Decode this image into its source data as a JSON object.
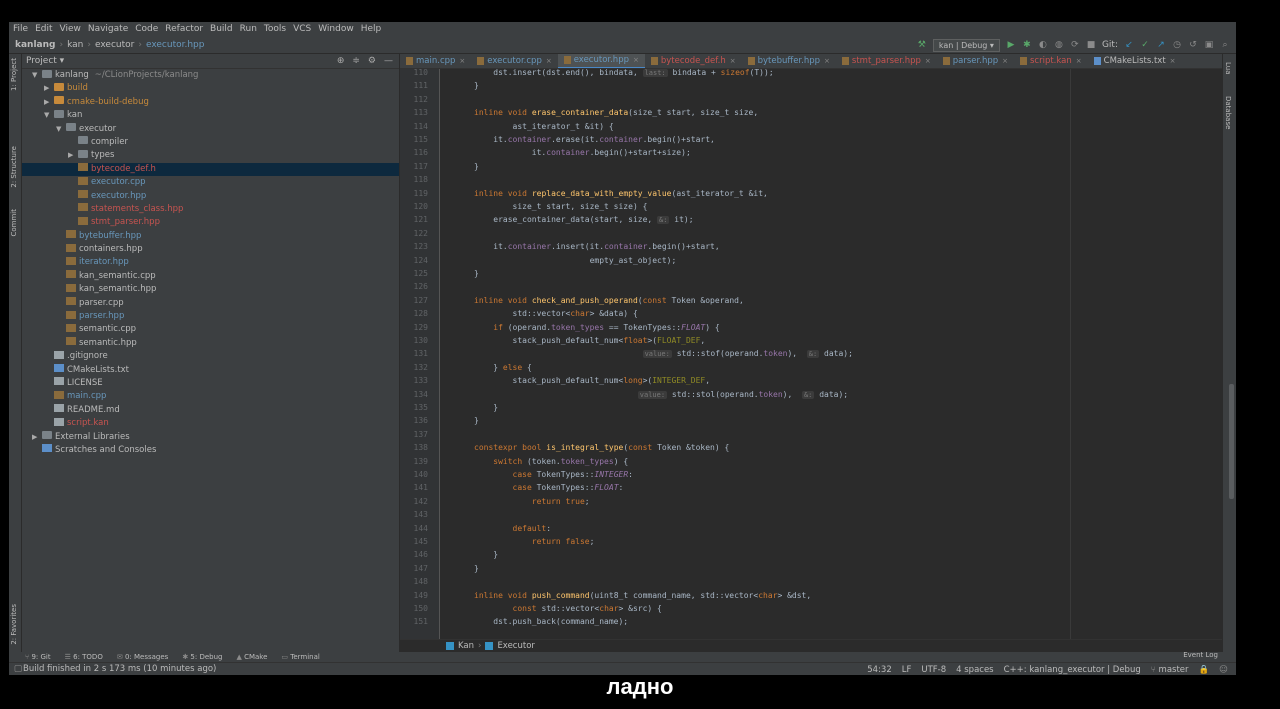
{
  "menu": [
    "File",
    "Edit",
    "View",
    "Navigate",
    "Code",
    "Refactor",
    "Build",
    "Run",
    "Tools",
    "VCS",
    "Window",
    "Help"
  ],
  "breadcrumbs": [
    "kanlang",
    "kan",
    "executor",
    "executor.hpp"
  ],
  "run_config": "kan | Debug ▾",
  "git_label": "Git:",
  "left_tabs": [
    "1: Project",
    "2: Structure",
    "Commit",
    "2: Favorites"
  ],
  "right_tabs": [
    "Lua",
    "Database"
  ],
  "project_panel": {
    "title": "Project ▾",
    "tree": [
      {
        "label": "kanlang",
        "extra": "~/CLionProjects/kanlang",
        "depth": 0,
        "arrow": "▼",
        "icon": "folder",
        "color": "default"
      },
      {
        "label": "build",
        "depth": 1,
        "arrow": "▶",
        "icon": "folder-orange",
        "color": "orange"
      },
      {
        "label": "cmake-build-debug",
        "depth": 1,
        "arrow": "▶",
        "icon": "folder-orange",
        "color": "orange"
      },
      {
        "label": "kan",
        "depth": 1,
        "arrow": "▼",
        "icon": "folder",
        "color": "default"
      },
      {
        "label": "executor",
        "depth": 2,
        "arrow": "▼",
        "icon": "folder",
        "color": "default"
      },
      {
        "label": "compiler",
        "depth": 3,
        "arrow": "",
        "icon": "folder",
        "color": "default"
      },
      {
        "label": "types",
        "depth": 3,
        "arrow": "▶",
        "icon": "folder",
        "color": "default"
      },
      {
        "label": "bytecode_def.h",
        "depth": 3,
        "arrow": "",
        "icon": "h",
        "color": "red",
        "selected": true
      },
      {
        "label": "executor.cpp",
        "depth": 3,
        "arrow": "",
        "icon": "h",
        "color": "blue"
      },
      {
        "label": "executor.hpp",
        "depth": 3,
        "arrow": "",
        "icon": "h",
        "color": "blue"
      },
      {
        "label": "statements_class.hpp",
        "depth": 3,
        "arrow": "",
        "icon": "h",
        "color": "red"
      },
      {
        "label": "stmt_parser.hpp",
        "depth": 3,
        "arrow": "",
        "icon": "h",
        "color": "red"
      },
      {
        "label": "bytebuffer.hpp",
        "depth": 2,
        "arrow": "",
        "icon": "h",
        "color": "blue"
      },
      {
        "label": "containers.hpp",
        "depth": 2,
        "arrow": "",
        "icon": "h",
        "color": "default"
      },
      {
        "label": "iterator.hpp",
        "depth": 2,
        "arrow": "",
        "icon": "h",
        "color": "blue"
      },
      {
        "label": "kan_semantic.cpp",
        "depth": 2,
        "arrow": "",
        "icon": "h",
        "color": "default"
      },
      {
        "label": "kan_semantic.hpp",
        "depth": 2,
        "arrow": "",
        "icon": "h",
        "color": "default"
      },
      {
        "label": "parser.cpp",
        "depth": 2,
        "arrow": "",
        "icon": "h",
        "color": "default"
      },
      {
        "label": "parser.hpp",
        "depth": 2,
        "arrow": "",
        "icon": "h",
        "color": "blue"
      },
      {
        "label": "semantic.cpp",
        "depth": 2,
        "arrow": "",
        "icon": "h",
        "color": "default"
      },
      {
        "label": "semantic.hpp",
        "depth": 2,
        "arrow": "",
        "icon": "h",
        "color": "default"
      },
      {
        "label": ".gitignore",
        "depth": 1,
        "arrow": "",
        "icon": "txt",
        "color": "default"
      },
      {
        "label": "CMakeLists.txt",
        "depth": 1,
        "arrow": "",
        "icon": "cmake",
        "color": "default"
      },
      {
        "label": "LICENSE",
        "depth": 1,
        "arrow": "",
        "icon": "txt",
        "color": "default"
      },
      {
        "label": "main.cpp",
        "depth": 1,
        "arrow": "",
        "icon": "h",
        "color": "blue"
      },
      {
        "label": "README.md",
        "depth": 1,
        "arrow": "",
        "icon": "txt",
        "color": "default"
      },
      {
        "label": "script.kan",
        "depth": 1,
        "arrow": "",
        "icon": "txt",
        "color": "red"
      },
      {
        "label": "External Libraries",
        "depth": 0,
        "arrow": "▶",
        "icon": "lib",
        "color": "default"
      },
      {
        "label": "Scratches and Consoles",
        "depth": 0,
        "arrow": "",
        "icon": "scratch",
        "color": "default"
      }
    ]
  },
  "editor_tabs": [
    {
      "label": "main.cpp",
      "color": "blue"
    },
    {
      "label": "executor.cpp",
      "color": "blue"
    },
    {
      "label": "executor.hpp",
      "color": "blue",
      "active": true
    },
    {
      "label": "bytecode_def.h",
      "color": "red"
    },
    {
      "label": "bytebuffer.hpp",
      "color": "blue"
    },
    {
      "label": "stmt_parser.hpp",
      "color": "red"
    },
    {
      "label": "parser.hpp",
      "color": "blue"
    },
    {
      "label": "script.kan",
      "color": "red"
    },
    {
      "label": "CMakeLists.txt",
      "color": "default"
    }
  ],
  "code_lines": [
    {
      "n": "110",
      "html": "    dst.insert(dst.end(), bindata, <span class='hint'>last:</span> bindata + <span class='k-kw'>sizeof</span>(T));"
    },
    {
      "n": "111",
      "html": "}"
    },
    {
      "n": "112",
      "html": ""
    },
    {
      "n": "113",
      "html": "<span class='k-kw'>inline void</span> <span class='k-fn'>erase_container_data</span>(size_t start, size_t size,"
    },
    {
      "n": "114",
      "html": "        ast_iterator_t &amp;it) {"
    },
    {
      "n": "115",
      "html": "    it.<span class='k-fld'>container</span>.erase(it.<span class='k-fld'>container</span>.begin()+start,"
    },
    {
      "n": "116",
      "html": "            it.<span class='k-fld'>container</span>.begin()+start+size);"
    },
    {
      "n": "117",
      "html": "}"
    },
    {
      "n": "118",
      "html": ""
    },
    {
      "n": "119",
      "html": "<span class='k-kw'>inline void</span> <span class='k-fn'>replace_data_with_empty_value</span>(ast_iterator_t &amp;it,"
    },
    {
      "n": "120",
      "html": "        size_t start, size_t size) {"
    },
    {
      "n": "121",
      "html": "    erase_container_data(start, size, <span class='hint'>&amp;:</span> it);"
    },
    {
      "n": "122",
      "html": ""
    },
    {
      "n": "123",
      "html": "    it.<span class='k-fld'>container</span>.insert(it.<span class='k-fld'>container</span>.begin()+start,"
    },
    {
      "n": "124",
      "html": "                        empty_ast_object);"
    },
    {
      "n": "125",
      "html": "}"
    },
    {
      "n": "126",
      "html": ""
    },
    {
      "n": "127",
      "html": "<span class='k-kw'>inline void</span> <span class='k-fn'>check_and_push_operand</span>(<span class='k-kw'>const</span> Token &amp;operand,"
    },
    {
      "n": "128",
      "html": "        std::vector&lt;<span class='k-kw'>char</span>&gt; &amp;data) {"
    },
    {
      "n": "129",
      "html": "    <span class='k-kw'>if</span> (operand.<span class='k-fld'>token_types</span> == TokenTypes::<span class='k-it'>FLOAT</span>) {"
    },
    {
      "n": "130",
      "html": "        stack_push_default_num&lt;<span class='k-kw'>float</span>&gt;(<span class='k-mac'>FLOAT_DEF</span>,"
    },
    {
      "n": "131",
      "html": "                                   <span class='hint'>value:</span> std::stof(operand.<span class='k-fld'>token</span>),  <span class='hint'>&amp;:</span> data);"
    },
    {
      "n": "132",
      "html": "    } <span class='k-kw'>else</span> {"
    },
    {
      "n": "133",
      "html": "        stack_push_default_num&lt;<span class='k-kw'>long</span>&gt;(<span class='k-mac'>INTEGER_DEF</span>,"
    },
    {
      "n": "134",
      "html": "                                  <span class='hint'>value:</span> std::stol(operand.<span class='k-fld'>token</span>),  <span class='hint'>&amp;:</span> data);"
    },
    {
      "n": "135",
      "html": "    }"
    },
    {
      "n": "136",
      "html": "}"
    },
    {
      "n": "137",
      "html": ""
    },
    {
      "n": "138",
      "html": "<span class='k-kw'>constexpr bool</span> <span class='k-fn'>is_integral_type</span>(<span class='k-kw'>const</span> Token &amp;token) {"
    },
    {
      "n": "139",
      "html": "    <span class='k-kw'>switch</span> (token.<span class='k-fld'>token_types</span>) {"
    },
    {
      "n": "140",
      "html": "        <span class='k-kw'>case</span> TokenTypes::<span class='k-it'>INTEGER</span>:"
    },
    {
      "n": "141",
      "html": "        <span class='k-kw'>case</span> TokenTypes::<span class='k-it'>FLOAT</span>:"
    },
    {
      "n": "142",
      "html": "            <span class='k-kw'>return true</span>;"
    },
    {
      "n": "143",
      "html": ""
    },
    {
      "n": "144",
      "html": "        <span class='k-kw'>default</span>:"
    },
    {
      "n": "145",
      "html": "            <span class='k-kw'>return false</span>;"
    },
    {
      "n": "146",
      "html": "    }"
    },
    {
      "n": "147",
      "html": "}"
    },
    {
      "n": "148",
      "html": ""
    },
    {
      "n": "149",
      "html": "<span class='k-kw'>inline void</span> <span class='k-fn'>push_command</span>(uint8_t command_name, std::vector&lt;<span class='k-kw'>char</span>&gt; &amp;dst,"
    },
    {
      "n": "150",
      "html": "        <span class='k-kw'>const</span> std::vector&lt;<span class='k-kw'>char</span>&gt; &amp;src) {"
    },
    {
      "n": "151",
      "html": "    dst.push_back(command_name);"
    }
  ],
  "code_breadcrumbs": [
    "Kan",
    "Executor"
  ],
  "tool_windows": [
    "9: Git",
    "6: TODO",
    "0: Messages",
    "5: Debug",
    "CMake",
    "Terminal"
  ],
  "event_log": "Event Log",
  "status": {
    "message": "Build finished in 2 s 173 ms (10 minutes ago)",
    "position": "54:32",
    "line_sep": "LF",
    "encoding": "UTF-8",
    "indent": "4 spaces",
    "context": "C++: kanlang_executor | Debug",
    "branch": "master"
  },
  "subtitle": "ладно"
}
